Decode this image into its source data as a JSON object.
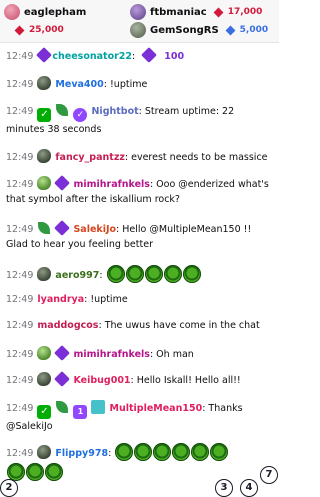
{
  "leaderboard": [
    {
      "name": "eaglepham",
      "score": "25,000",
      "gem": "red"
    },
    {
      "name": "ftbmaniac",
      "score": "17,000",
      "gem": "red"
    },
    {
      "name": "GemSongRS",
      "score": "5,000",
      "gem": "blue"
    }
  ],
  "messages": [
    {
      "ts": "12:49",
      "user": "cheesonator22",
      "color": "#00a2a2",
      "sep": ":",
      "text": "100",
      "text_color": "#7b2fd6",
      "badges": [
        "purple-gem-icon"
      ]
    },
    {
      "ts": "12:49",
      "user": "Meva400",
      "color": "#1e6fe0",
      "sep": ":",
      "text": "!uptime",
      "badges": [
        "rock-icon"
      ]
    },
    {
      "ts": "12:49",
      "user": "Nightbot",
      "color": "#5c6bc0",
      "sep": ":",
      "text": "Stream uptime: 22 minutes 38 seconds",
      "badges": [
        "check-icon",
        "leaf-icon",
        "verified-icon"
      ]
    },
    {
      "ts": "12:49",
      "user": "fancy_pantzz",
      "color": "#c41e52",
      "sep": ":",
      "text": "everest needs to be massice",
      "badges": [
        "rock-icon"
      ]
    },
    {
      "ts": "12:49",
      "user": "mimihrafnkels",
      "color": "#b5148b",
      "sep": ":",
      "text": "Ooo @enderized what's that symbol after the iskallium rock?",
      "badges": [
        "rock-green-icon",
        "purple-gem-icon"
      ]
    },
    {
      "ts": "12:49",
      "user": "SalekiJo",
      "color": "#d6451f",
      "sep": ":",
      "text": "Hello @MultipleMean150 !! Glad to hear you feeling better",
      "badges": [
        "leaf-icon",
        "purple-gem-icon"
      ]
    },
    {
      "ts": "12:49",
      "user": "aero997",
      "color": "#3a6f1c",
      "sep": ":",
      "text": "",
      "badges": [
        "rock-icon"
      ],
      "emotes": 5
    },
    {
      "ts": "12:49",
      "user": "lyandrya",
      "color": "#e0205e",
      "sep": ":",
      "text": "!uptime",
      "badges": []
    },
    {
      "ts": "12:49",
      "user": "maddogcos",
      "color": "#c41e52",
      "sep": ":",
      "text": "The uwus have come in the chat",
      "badges": []
    },
    {
      "ts": "12:49",
      "user": "mimihrafnkels",
      "color": "#b5148b",
      "sep": ":",
      "text": "Oh man",
      "badges": [
        "rock-green-icon",
        "purple-gem-icon"
      ]
    },
    {
      "ts": "12:49",
      "user": "Keibug001",
      "color": "#e0205e",
      "sep": ":",
      "text": "Hello Iskall! Hello all!!",
      "badges": [
        "rock-icon",
        "purple-gem-icon"
      ]
    },
    {
      "ts": "12:49",
      "user": "MultipleMean150",
      "color": "#e0205e",
      "sep": ":",
      "text": "Thanks @SalekiJo",
      "badges": [
        "check-icon",
        "leaf-icon",
        "tier-icon",
        "gift-icon"
      ]
    },
    {
      "ts": "12:49",
      "user": "Flippy978",
      "color": "#1e6fe0",
      "sep": ":",
      "text": "",
      "badges": [
        "rock-icon"
      ],
      "emotes": 9
    }
  ],
  "floating_buttons": {
    "left": "2",
    "middle1": "3",
    "middle2": "4",
    "right": "7"
  },
  "colors": {
    "accent": "#9147ff",
    "emote_green": "#4caf22"
  }
}
